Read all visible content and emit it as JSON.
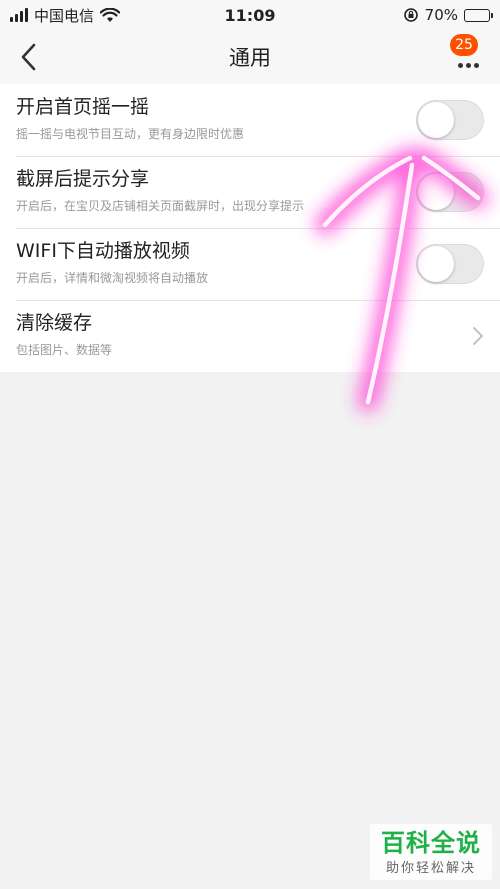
{
  "status_bar": {
    "carrier": "中国电信",
    "time": "11:09",
    "battery_text": "70%",
    "battery_level": 0.7
  },
  "nav": {
    "title": "通用",
    "badge_count": "25"
  },
  "settings": [
    {
      "title": "开启首页摇一摇",
      "desc": "摇一摇与电视节目互动，更有身边限时优惠",
      "control": "toggle",
      "on": false
    },
    {
      "title": "截屏后提示分享",
      "desc": "开启后，在宝贝及店铺相关页面截屏时，出现分享提示",
      "control": "toggle",
      "on": false
    },
    {
      "title": "WIFI下自动播放视频",
      "desc": "开启后，详情和微淘视频将自动播放",
      "control": "toggle",
      "on": false
    },
    {
      "title": "清除缓存",
      "desc": "包括图片、数据等",
      "control": "chevron"
    }
  ],
  "watermark": {
    "main": "百科全说",
    "sub": "助你轻松解决"
  },
  "colors": {
    "badge": "#ff5000",
    "annotation": "#ff2fd0",
    "watermark": "#1fb146"
  }
}
